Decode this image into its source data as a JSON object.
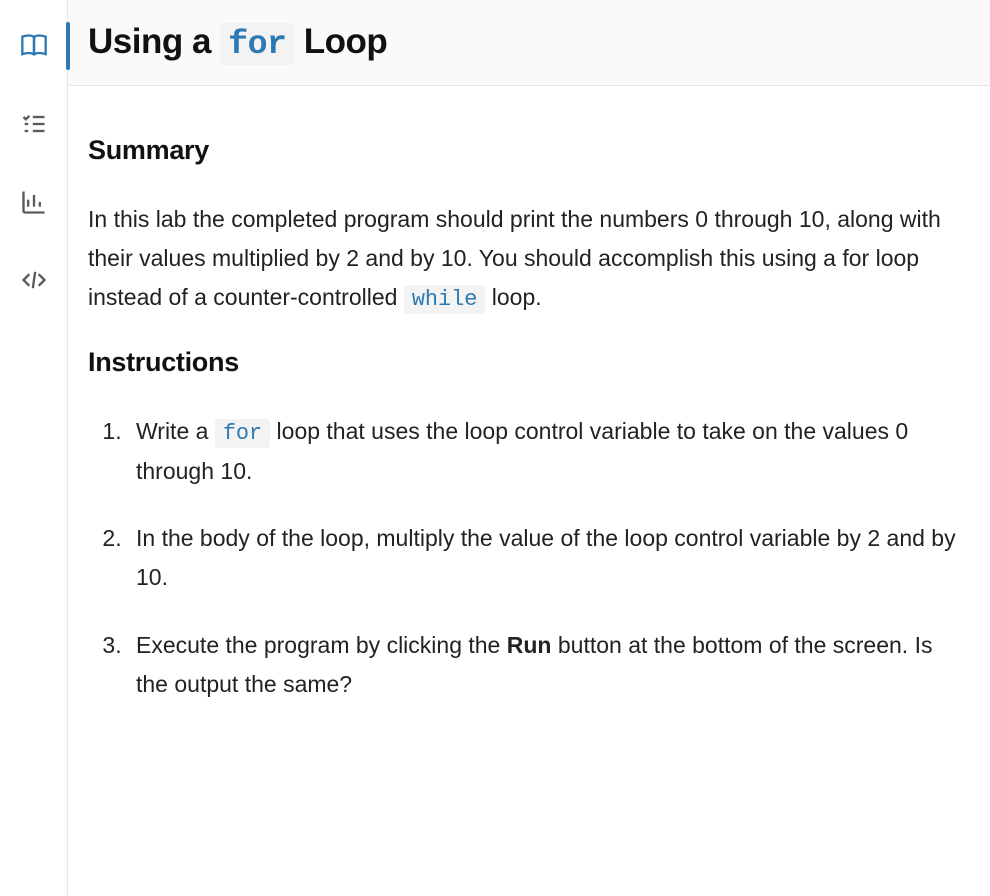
{
  "sidebar": {
    "items": [
      {
        "name": "book-icon",
        "active": true
      },
      {
        "name": "checklist-icon",
        "active": false
      },
      {
        "name": "chart-icon",
        "active": false
      },
      {
        "name": "code-icon",
        "active": false
      }
    ]
  },
  "header": {
    "title_pre": "Using a ",
    "title_code": "for",
    "title_post": " Loop"
  },
  "content": {
    "summary_heading": "Summary",
    "summary_p1_pre": "In this lab the completed program should print the numbers 0 through 10, along with their values multiplied by 2 and by 10. You should accomplish this using a for loop instead of a counter-controlled ",
    "summary_p1_code": "while",
    "summary_p1_post": " loop.",
    "instructions_heading": "Instructions",
    "steps": [
      {
        "pre": "Write a ",
        "code": "for",
        "post": " loop that uses the loop control variable to take on the values 0 through 10."
      },
      {
        "text": "In the body of the loop, multiply the value of the loop control variable by 2 and by 10."
      },
      {
        "pre": "Execute the program by clicking the ",
        "strong": "Run",
        "post": " button at the bottom of the screen. Is the output the same?"
      }
    ]
  }
}
